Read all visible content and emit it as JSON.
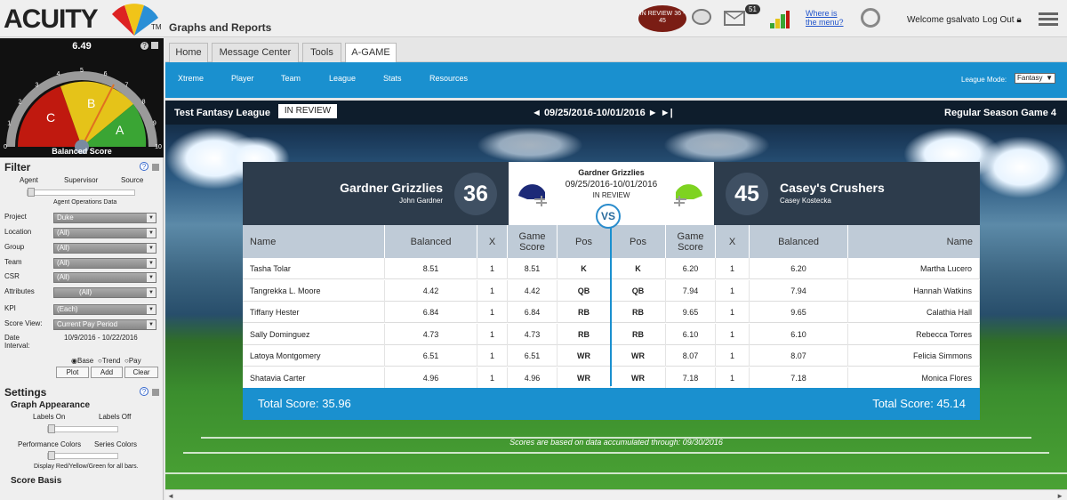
{
  "app": {
    "logo": "ACUITY",
    "logo_tm": "TM",
    "title": "Graphs and Reports",
    "review_badge": "IN REVIEW 36 - 45",
    "mail_count": "51",
    "where_link": "Where is the menu?",
    "welcome": "Welcome gsalvato",
    "logout": "Log Out"
  },
  "gauge": {
    "value": "6.49",
    "label": "Balanced Score",
    "zones": [
      "C",
      "B",
      "A"
    ],
    "ticks": [
      "0",
      "1",
      "2",
      "3",
      "4",
      "5",
      "6",
      "7",
      "8",
      "9",
      "10"
    ],
    "colors": {
      "c": "#c0190f",
      "b": "#e5c319",
      "a": "#3aa534"
    }
  },
  "filter": {
    "heading": "Filter",
    "help": "?",
    "slider_labels": [
      "Agent",
      "Supervisor",
      "Source"
    ],
    "slider_caption": "Agent Operations Data",
    "fields": [
      {
        "label": "Project",
        "value": "Duke"
      },
      {
        "label": "Location",
        "value": "(All)"
      },
      {
        "label": "Group",
        "value": "(All)"
      },
      {
        "label": "Team",
        "value": "(All)"
      },
      {
        "label": "CSR",
        "value": "(All)"
      },
      {
        "label": "Attributes",
        "value": "(All)"
      },
      {
        "label": "KPI",
        "value": "(Each)"
      },
      {
        "label": "Score View:",
        "value": "Current Pay Period"
      }
    ],
    "date_label": "Date Interval:",
    "date_value": "10/9/2016 - 10/22/2016",
    "radios": [
      "Base",
      "Trend",
      "Pay"
    ],
    "buttons": [
      "Plot",
      "Add",
      "Clear"
    ]
  },
  "settings": {
    "heading": "Settings",
    "help": "?",
    "graph_appearance": "Graph Appearance",
    "labels_on": "Labels On",
    "labels_off": "Labels Off",
    "perf_colors": "Performance Colors",
    "series_colors": "Series Colors",
    "display_note": "Display Red/Yellow/Green for all bars.",
    "score_basis": "Score Basis"
  },
  "tabs": [
    "Home",
    "Message Center",
    "Tools",
    "A-GAME"
  ],
  "subnav": [
    "Xtreme",
    "Player",
    "Team",
    "League",
    "Stats",
    "Resources"
  ],
  "league_mode": {
    "label": "League Mode:",
    "value": "Fantasy"
  },
  "game": {
    "league_name": "Test Fantasy League",
    "status": "IN REVIEW",
    "period": "◄ 09/25/2016-10/01/2016 ►   ►|",
    "game_label": "Regular Season Game 4",
    "vs": "VS",
    "center_team": "Gardner Grizzlies",
    "center_dates": "09/25/2016-10/01/2016",
    "center_status": "IN REVIEW",
    "note": "Scores are based on data accumulated through: 09/30/2016"
  },
  "home": {
    "name": "Gardner Grizzlies",
    "owner": "John Gardner",
    "score": "36",
    "total": "Total Score: 35.96",
    "helmet_color": "#1d2a78"
  },
  "away": {
    "name": "Casey's Crushers",
    "owner": "Casey Kostecka",
    "score": "45",
    "total": "Total Score: 45.14",
    "helmet_color": "#7ed321"
  },
  "columns": {
    "left": [
      "Name",
      "Balanced",
      "X",
      "Game Score",
      "Pos"
    ],
    "right": [
      "Pos",
      "Game Score",
      "X",
      "Balanced",
      "Name"
    ]
  },
  "rows": [
    {
      "l_name": "Tasha Tolar",
      "l_bal": "8.51",
      "l_x": "1",
      "l_gs": "8.51",
      "l_pos": "K",
      "r_pos": "K",
      "r_gs": "6.20",
      "r_x": "1",
      "r_bal": "6.20",
      "r_name": "Martha Lucero"
    },
    {
      "l_name": "Tangrekka L. Moore",
      "l_bal": "4.42",
      "l_x": "1",
      "l_gs": "4.42",
      "l_pos": "QB",
      "r_pos": "QB",
      "r_gs": "7.94",
      "r_x": "1",
      "r_bal": "7.94",
      "r_name": "Hannah Watkins"
    },
    {
      "l_name": "Tiffany Hester",
      "l_bal": "6.84",
      "l_x": "1",
      "l_gs": "6.84",
      "l_pos": "RB",
      "r_pos": "RB",
      "r_gs": "9.65",
      "r_x": "1",
      "r_bal": "9.65",
      "r_name": "Calathia Hall"
    },
    {
      "l_name": "Sally Dominguez",
      "l_bal": "4.73",
      "l_x": "1",
      "l_gs": "4.73",
      "l_pos": "RB",
      "r_pos": "RB",
      "r_gs": "6.10",
      "r_x": "1",
      "r_bal": "6.10",
      "r_name": "Rebecca Torres"
    },
    {
      "l_name": "Latoya Montgomery",
      "l_bal": "6.51",
      "l_x": "1",
      "l_gs": "6.51",
      "l_pos": "WR",
      "r_pos": "WR",
      "r_gs": "8.07",
      "r_x": "1",
      "r_bal": "8.07",
      "r_name": "Felicia Simmons"
    },
    {
      "l_name": "Shatavia Carter",
      "l_bal": "4.96",
      "l_x": "1",
      "l_gs": "4.96",
      "l_pos": "WR",
      "r_pos": "WR",
      "r_gs": "7.18",
      "r_x": "1",
      "r_bal": "7.18",
      "r_name": "Monica Flores"
    }
  ]
}
